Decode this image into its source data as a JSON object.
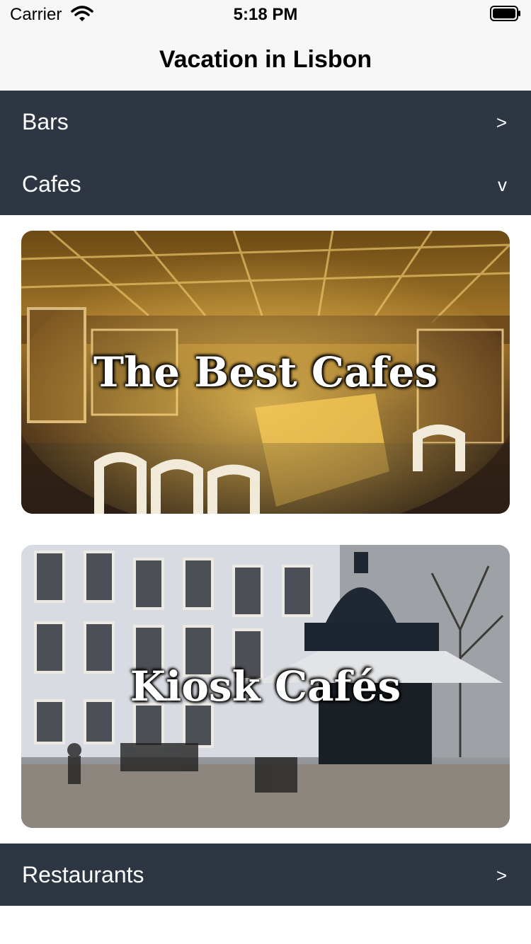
{
  "status_bar": {
    "carrier": "Carrier",
    "time": "5:18 PM",
    "wifi_icon": "wifi-icon",
    "battery_icon": "battery-full-icon"
  },
  "nav": {
    "title": "Vacation in Lisbon"
  },
  "sections": [
    {
      "label": "Bars",
      "chevron": ">",
      "expanded": false
    },
    {
      "label": "Cafes",
      "chevron": "v",
      "expanded": true
    },
    {
      "label": "Restaurants",
      "chevron": ">",
      "expanded": false
    }
  ],
  "cards": [
    {
      "title": "The Best Cafes",
      "image": "ornate cafe interior photo"
    },
    {
      "title": "Kiosk Cafés",
      "image": "street kiosk cafe photo"
    }
  ],
  "colors": {
    "section_background": "#2d3642",
    "section_text": "#ffffff",
    "nav_background": "#f7f7f7"
  }
}
